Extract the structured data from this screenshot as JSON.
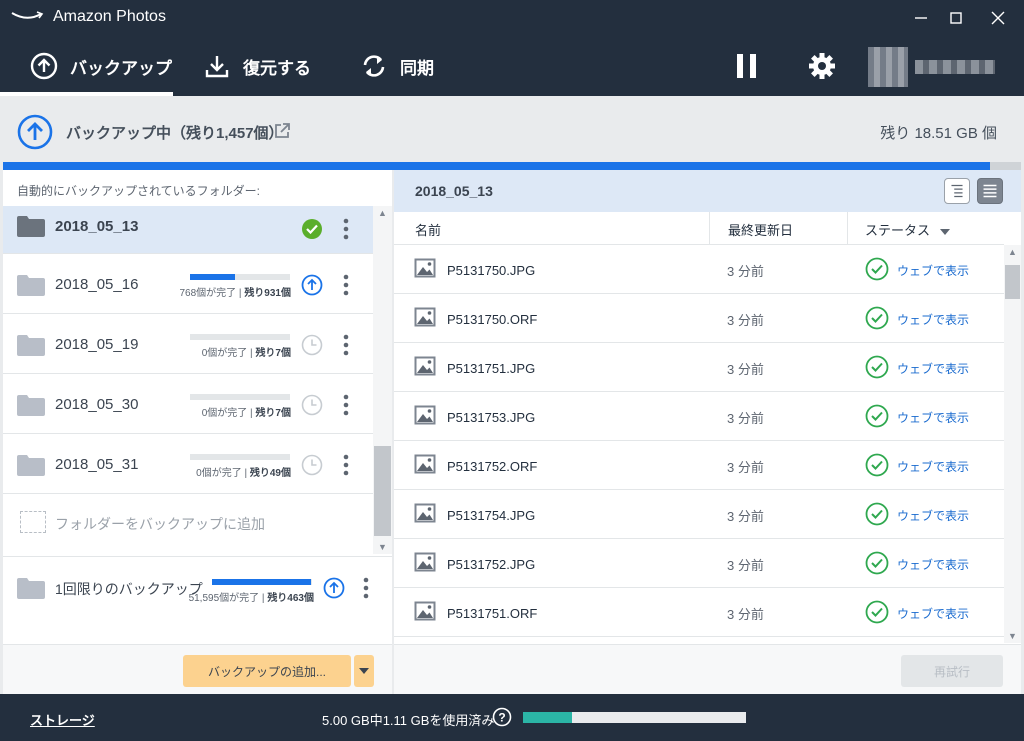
{
  "window": {
    "title": "Amazon Photos"
  },
  "nav": {
    "tabs": [
      {
        "label": "バックアップ",
        "active": true
      },
      {
        "label": "復元する",
        "active": false
      },
      {
        "label": "同期",
        "active": false
      }
    ]
  },
  "status": {
    "text": "バックアップ中（残り1,457個）",
    "remaining": "残り 18.51 GB 個",
    "progress_percent": 97
  },
  "left": {
    "header": "自動的にバックアップされているフォルダー:",
    "folders": [
      {
        "name": "2018_05_13",
        "status": "done"
      },
      {
        "name": "2018_05_16",
        "done_text": "768個が完了",
        "remain_text": "残り931個",
        "progress": 0.45,
        "status": "uploading"
      },
      {
        "name": "2018_05_19",
        "done_text": "0個が完了",
        "remain_text": "残り7個",
        "progress": 0,
        "status": "pending"
      },
      {
        "name": "2018_05_30",
        "done_text": "0個が完了",
        "remain_text": "残り7個",
        "progress": 0,
        "status": "pending"
      },
      {
        "name": "2018_05_31",
        "done_text": "0個が完了",
        "remain_text": "残り49個",
        "progress": 0,
        "status": "pending"
      }
    ],
    "add_folder_label": "フォルダーをバックアップに追加",
    "onetime": {
      "name": "1回限りのバックアップ",
      "done_text": "51,595個が完了",
      "remain_text": "残り463個",
      "progress": 0.99
    },
    "add_backup_button": "バックアップの追加..."
  },
  "right": {
    "folder_title": "2018_05_13",
    "columns": {
      "name": "名前",
      "modified": "最終更新日",
      "status": "ステータス"
    },
    "files": [
      {
        "name": "P5131750.JPG",
        "modified": "3 分前",
        "status": "ウェブで表示"
      },
      {
        "name": "P5131750.ORF",
        "modified": "3 分前",
        "status": "ウェブで表示"
      },
      {
        "name": "P5131751.JPG",
        "modified": "3 分前",
        "status": "ウェブで表示"
      },
      {
        "name": "P5131753.JPG",
        "modified": "3 分前",
        "status": "ウェブで表示"
      },
      {
        "name": "P5131752.ORF",
        "modified": "3 分前",
        "status": "ウェブで表示"
      },
      {
        "name": "P5131754.JPG",
        "modified": "3 分前",
        "status": "ウェブで表示"
      },
      {
        "name": "P5131752.JPG",
        "modified": "3 分前",
        "status": "ウェブで表示"
      },
      {
        "name": "P5131751.ORF",
        "modified": "3 分前",
        "status": "ウェブで表示"
      }
    ],
    "retry_button": "再試行"
  },
  "bottom": {
    "storage_link": "ストレージ",
    "usage_text": "5.00 GB中1.11 GBを使用済み",
    "usage_fraction": 0.22
  },
  "colors": {
    "accent": "#1a73e8",
    "success": "#2fa84f",
    "dark": "#232f3e",
    "button": "#fcd28f"
  }
}
